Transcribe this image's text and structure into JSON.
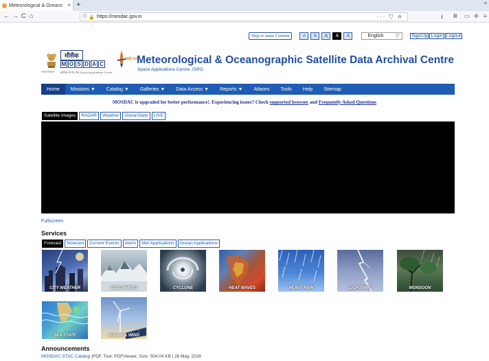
{
  "browser": {
    "tab_title": "Meteorological & Oceanc",
    "tab_close": "×",
    "new_tab": "+",
    "window_close": "×",
    "url": "https://mosdac.gov.in",
    "back_icon": "arrow-left",
    "forward_icon": "arrow-right",
    "reload_icon": "reload",
    "home_icon": "home"
  },
  "topbar": {
    "skip_label": "Skip to main Content",
    "font_small": "A",
    "font_medium": "A",
    "font_large": "A",
    "contrast_dark": "A",
    "contrast_light": "A",
    "language": "English",
    "signup": "SignUp",
    "login": "Login",
    "logout": "Logout"
  },
  "header": {
    "logo_hindi": "मौसैक",
    "logo_letters": [
      "M",
      "O",
      "S",
      "D",
      "A",
      "C"
    ],
    "logo_caption": "अंतरिक्ष उपयोग केंद्र  Space Applications Centre",
    "emblem_caption": "भारत सरकार",
    "isro_text": "इसरो isro",
    "title": "Meteorological & Oceanographic Satellite Data Archival Centre",
    "subtitle": "Space Applications Centre, ISRO"
  },
  "menu": [
    {
      "label": "Home"
    },
    {
      "label": "Missions ▼"
    },
    {
      "label": "Catalog ▼"
    },
    {
      "label": "Galleries ▼"
    },
    {
      "label": "Data Access ▼"
    },
    {
      "label": "Reports ▼"
    },
    {
      "label": "Atlases"
    },
    {
      "label": "Tools"
    },
    {
      "label": "Help"
    },
    {
      "label": "Sitemap"
    }
  ],
  "notice": {
    "text": "MOSDAC is upgraded for better performance!. Experiencing issues? Check",
    "link1": "supported browser",
    "and": "and",
    "link2": "Frequently Asked Questions"
  },
  "image_tabs": [
    "Satellite Images",
    "RADAR",
    "Weather",
    "OceanState",
    "LIVE"
  ],
  "fullscreen": "Fullscreen",
  "services": {
    "heading": "Services",
    "tabs": [
      "Forecast",
      "Nowcast",
      "Current Events",
      "Alerts",
      "Met Applications",
      "Ocean Applications"
    ],
    "tiles": [
      "CITY WEATHER",
      "COLD WAVES",
      "CYCLONE",
      "HEAT WAVES",
      "HEAVY RAIN",
      "LIGHTNING",
      "MONSOON",
      "SEA STATE",
      "SOLAR & WIND"
    ]
  },
  "announcements": {
    "heading": "Announcements",
    "link": "MOSDAC STAC Catalog",
    "detail": "|PDF, Tool: PDFViewer, Size: 504.04 KB | 26 May, 2026"
  }
}
